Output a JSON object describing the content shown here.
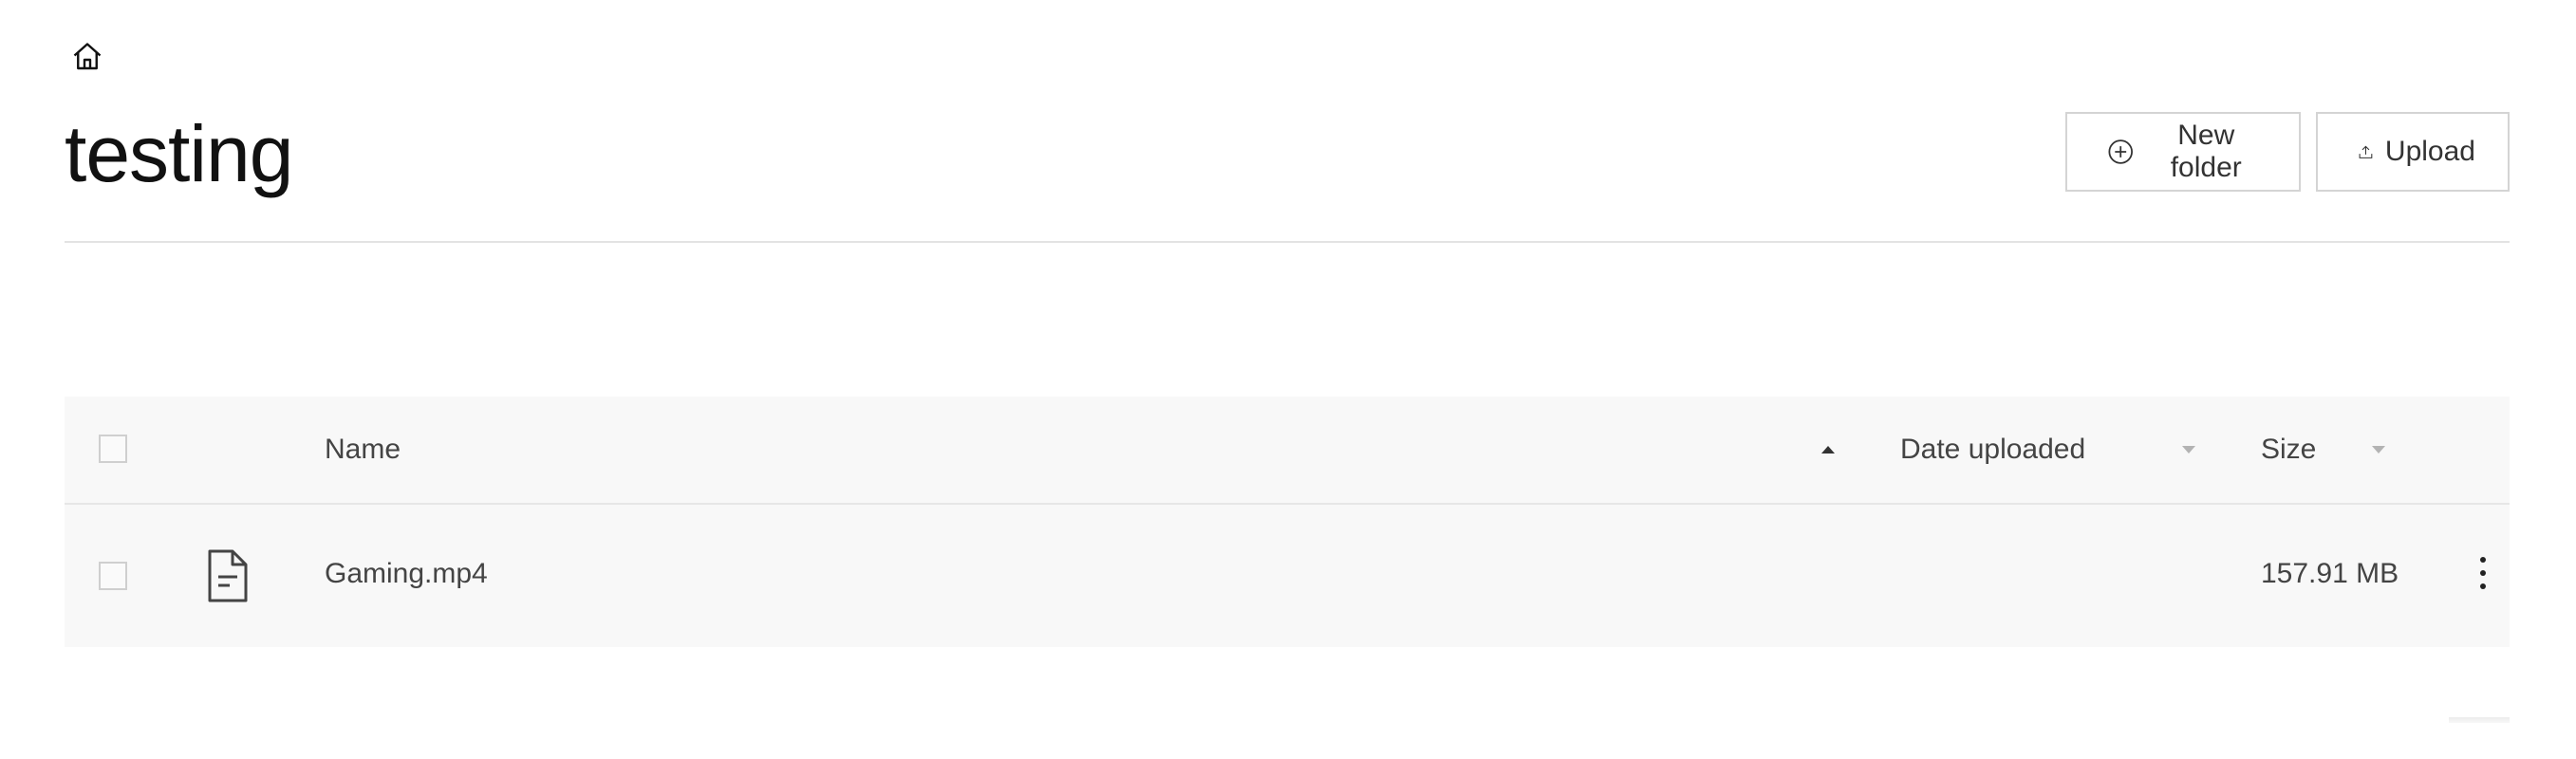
{
  "header": {
    "home_icon": "home-icon",
    "title": "testing",
    "buttons": {
      "new_folder": {
        "label": "New folder",
        "icon": "plus-circle-icon"
      },
      "upload": {
        "label": "Upload",
        "icon": "upload-icon"
      }
    }
  },
  "table": {
    "columns": {
      "name": "Name",
      "date_uploaded": "Date uploaded",
      "size": "Size"
    },
    "sort": {
      "column": "name",
      "direction": "ascending"
    },
    "rows": [
      {
        "type_icon": "file-icon",
        "name": "Gaming.mp4",
        "date_uploaded": "",
        "size": "157.91 MB"
      }
    ]
  },
  "colors": {
    "header_bg": "#f8f8f8",
    "text": "#444444",
    "border": "#d4d4d4"
  }
}
